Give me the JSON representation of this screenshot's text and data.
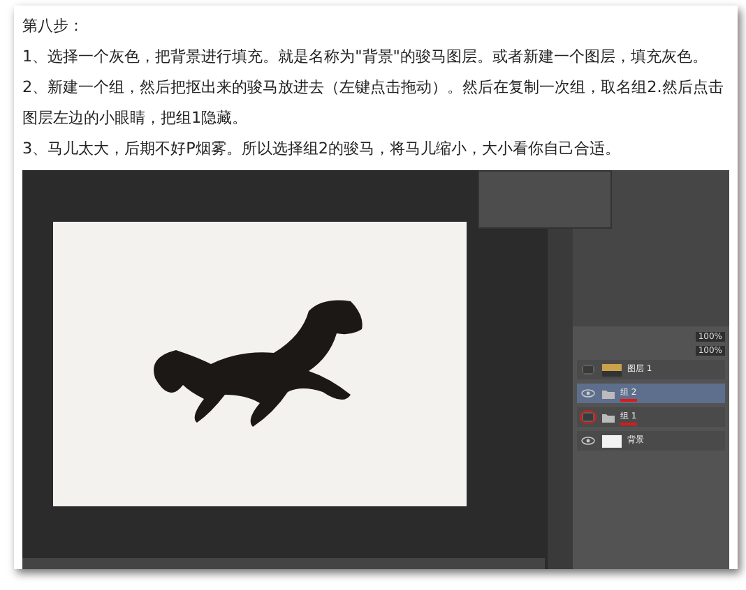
{
  "heading": "第八步：",
  "steps": [
    "1、选择一个灰色，把背景进行填充。就是名称为\"背景\"的骏马图层。或者新建一个图层，填充灰色。",
    "2、新建一个组，然后把抠出来的骏马放进去（左键点击拖动）。然后在复制一次组，取名组2.然后点击图层左边的小眼睛，把组1隐藏。",
    "3、马儿太大，后期不好P烟雾。所以选择组2的骏马，将马儿缩小，大小看你自己合适。"
  ],
  "editor": {
    "opacity": "100%",
    "fill": "100%",
    "layers": [
      {
        "name": "图层 1",
        "kind": "layer",
        "visible": false,
        "selected": false,
        "marked": false
      },
      {
        "name": "组 2",
        "kind": "group",
        "visible": true,
        "selected": true,
        "marked": true
      },
      {
        "name": "组 1",
        "kind": "group",
        "visible": false,
        "selected": false,
        "marked": true
      },
      {
        "name": "背景",
        "kind": "background",
        "visible": true,
        "selected": false,
        "marked": false
      }
    ]
  }
}
